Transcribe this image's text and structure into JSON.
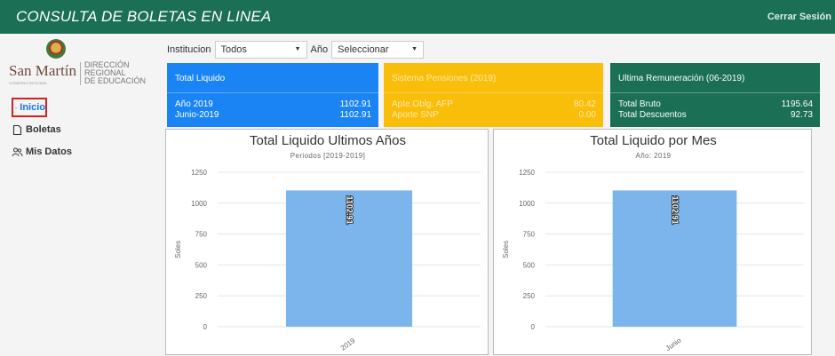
{
  "header": {
    "title": "CONSULTA DE BOLETAS EN LINEA",
    "logout": "Cerrar Sesión"
  },
  "logo": {
    "name": "San Martín",
    "sub": "GOBIERNO REGIONAL",
    "line1": "DIRECCIÓN",
    "line2": "REGIONAL",
    "line3": "DE EDUCACIÓN"
  },
  "nav": [
    {
      "label": "Inicio",
      "icon": "home-icon"
    },
    {
      "label": "Boletas",
      "icon": "document-icon"
    },
    {
      "label": "Mis Datos",
      "icon": "users-icon"
    }
  ],
  "filters": {
    "institucion_label": "Institucion",
    "institucion_value": "Todos",
    "anio_label": "Año",
    "anio_value": "Seleccionar"
  },
  "cards": {
    "total_liquido": {
      "title": "Total Liquido",
      "row1_label": "Año 2019",
      "row1_value": "1102.91",
      "row2_label": "Junio-2019",
      "row2_value": "1102.91"
    },
    "pensiones": {
      "title": "Sistema Pensiones (2019)",
      "row1_label": "Apte.Oblg. AFP",
      "row1_value": "80.42",
      "row2_label": "Aporte SNP",
      "row2_value": "0.00"
    },
    "remuneracion": {
      "title": "Ultima Remuneración (06-2019)",
      "row1_label": "Total Bruto",
      "row1_value": "1195.64",
      "row2_label": "Total Descuentos",
      "row2_value": "92.73"
    }
  },
  "colors": {
    "header": "#1b6f55",
    "blue": "#1a84f4",
    "yellow": "#f9be0a",
    "green": "#1b6f55",
    "bar": "#7cb5ec"
  },
  "chart_data": [
    {
      "type": "bar",
      "title": "Total Liquido Ultimos Años",
      "subtitle": "Periodos [2019-2019]",
      "ylabel": "Soles",
      "categories": [
        "2019"
      ],
      "values": [
        1102.91
      ],
      "data_labels": [
        "1102.91"
      ],
      "ylim": [
        0,
        1250
      ],
      "yticks": [
        0,
        250,
        500,
        750,
        1000,
        1250
      ],
      "ytick_labels": [
        "0",
        "250",
        "500",
        "750",
        "1000",
        "1250"
      ],
      "grid": true
    },
    {
      "type": "bar",
      "title": "Total Liquido por Mes",
      "subtitle": "Año: 2019",
      "ylabel": "Soles",
      "categories": [
        "Junio"
      ],
      "values": [
        1102.91
      ],
      "data_labels": [
        "1102.91"
      ],
      "ylim": [
        0,
        1250
      ],
      "yticks": [
        0,
        250,
        500,
        750,
        1000,
        1250
      ],
      "ytick_labels": [
        "0",
        "250",
        "500",
        "750",
        "1000",
        "1250"
      ],
      "grid": true
    }
  ]
}
